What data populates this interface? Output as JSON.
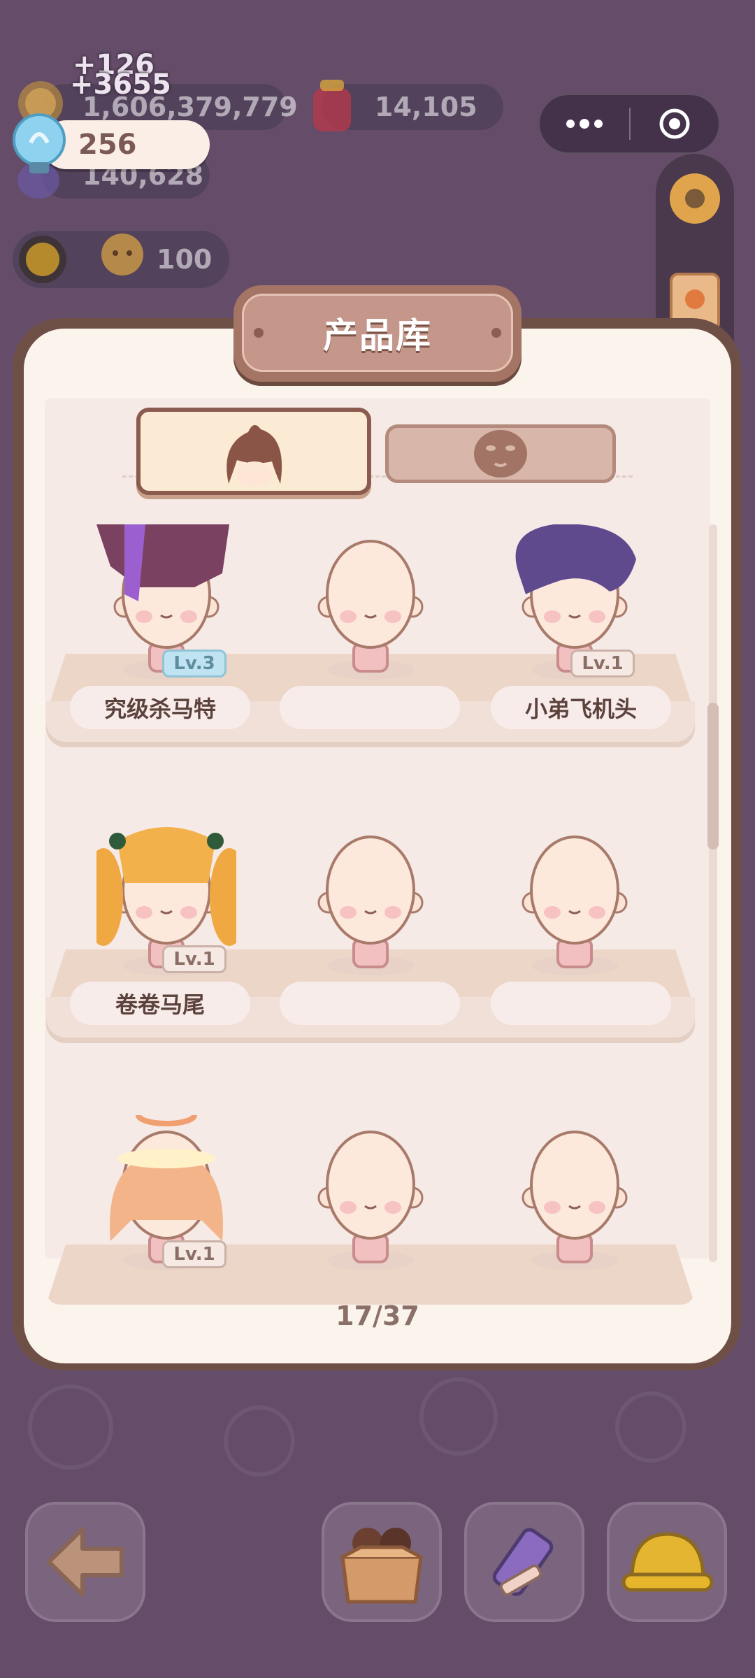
{
  "resources": {
    "coins": "1,606,379,779",
    "gems": "14,105",
    "bulbs": "256",
    "purple_item": "140,628",
    "cookies": "100",
    "floating_gain_a": "+126",
    "floating_gain_b": "+3655"
  },
  "modal": {
    "title": "产品库",
    "tabs": [
      {
        "icon": "hair-icon",
        "active": true
      },
      {
        "icon": "face-icon",
        "active": false
      }
    ],
    "shelves": [
      {
        "slots": [
          {
            "name": "究级杀马特",
            "level": "Lv.3",
            "hair": "punk-purple"
          },
          {
            "name": "",
            "level": "",
            "hair": "none"
          },
          {
            "name": "小弟飞机头",
            "level": "Lv.1",
            "hair": "pompadour-purple"
          }
        ]
      },
      {
        "slots": [
          {
            "name": "卷卷马尾",
            "level": "Lv.1",
            "hair": "curly-twintails"
          },
          {
            "name": "",
            "level": "",
            "hair": "none"
          },
          {
            "name": "",
            "level": "",
            "hair": "none"
          }
        ]
      },
      {
        "slots": [
          {
            "name": "",
            "level": "Lv.1",
            "hair": "halo-flower"
          },
          {
            "name": "",
            "level": "",
            "hair": "none"
          },
          {
            "name": "",
            "level": "",
            "hair": "none"
          }
        ]
      }
    ],
    "page_counter": "17/37"
  },
  "bottom_bar": [
    "back-arrow-icon",
    "box-icon",
    "pencil-icon",
    "hardhat-icon"
  ],
  "colors": {
    "background": "#654d6a",
    "panel": "#fbf4ec",
    "frame": "#6e4f45",
    "accent": "#c5968a"
  }
}
